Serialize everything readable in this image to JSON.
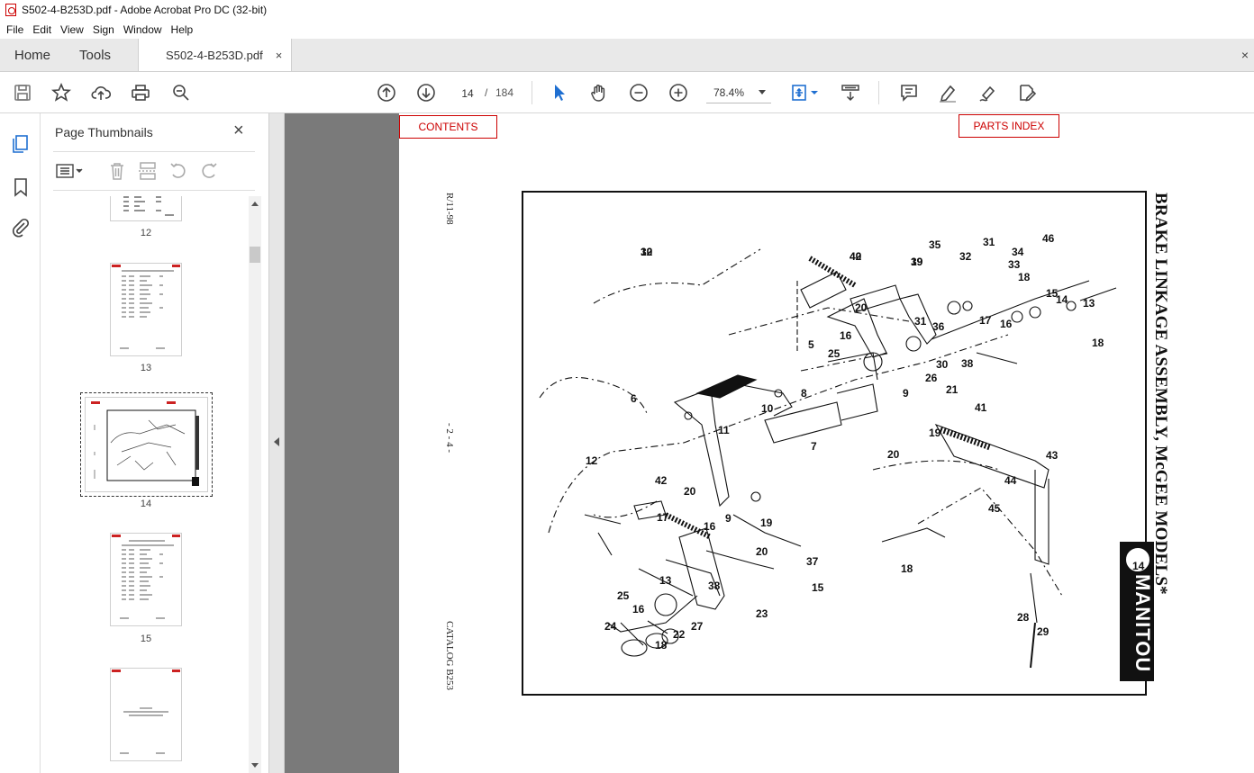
{
  "window": {
    "title": "S502-4-B253D.pdf - Adobe Acrobat Pro DC (32-bit)"
  },
  "menu": [
    "File",
    "Edit",
    "View",
    "Sign",
    "Window",
    "Help"
  ],
  "tabs": {
    "home": "Home",
    "tools": "Tools",
    "document": "S502-4-B253D.pdf",
    "close_glyph": "×"
  },
  "toolbar": {
    "page_current": "14",
    "page_separator": "/",
    "page_total": "184",
    "zoom": "78.4%"
  },
  "thumbnails_panel": {
    "title": "Page Thumbnails",
    "pages": [
      {
        "label": "12"
      },
      {
        "label": "13"
      },
      {
        "label": "14",
        "selected": true
      },
      {
        "label": "15"
      },
      {
        "label": ""
      }
    ]
  },
  "document": {
    "contents_link": "CONTENTS",
    "parts_index_link": "PARTS INDEX",
    "revision": "R/11-98",
    "page_number": "- 2 - 4 -",
    "catalog": "CATALOG B253",
    "heading": "BRAKE LINKAGE ASSEMBLY, McGEE MODELS*",
    "logo_text": "MANITOU",
    "callouts": [
      "12",
      "42",
      "19",
      "35",
      "32",
      "31",
      "34",
      "46",
      "33",
      "18",
      "15",
      "14",
      "13",
      "20",
      "31",
      "36",
      "17",
      "16",
      "18",
      "16",
      "25",
      "5",
      "30",
      "38",
      "26",
      "21",
      "6",
      "8",
      "9",
      "10",
      "11",
      "7",
      "19",
      "41",
      "20",
      "43",
      "12",
      "42",
      "20",
      "9",
      "44",
      "45",
      "17",
      "16",
      "19",
      "18",
      "20",
      "37",
      "15",
      "14",
      "13",
      "38",
      "25",
      "16",
      "23",
      "24",
      "18",
      "22",
      "27",
      "28",
      "29",
      "30",
      "40",
      "39"
    ]
  }
}
